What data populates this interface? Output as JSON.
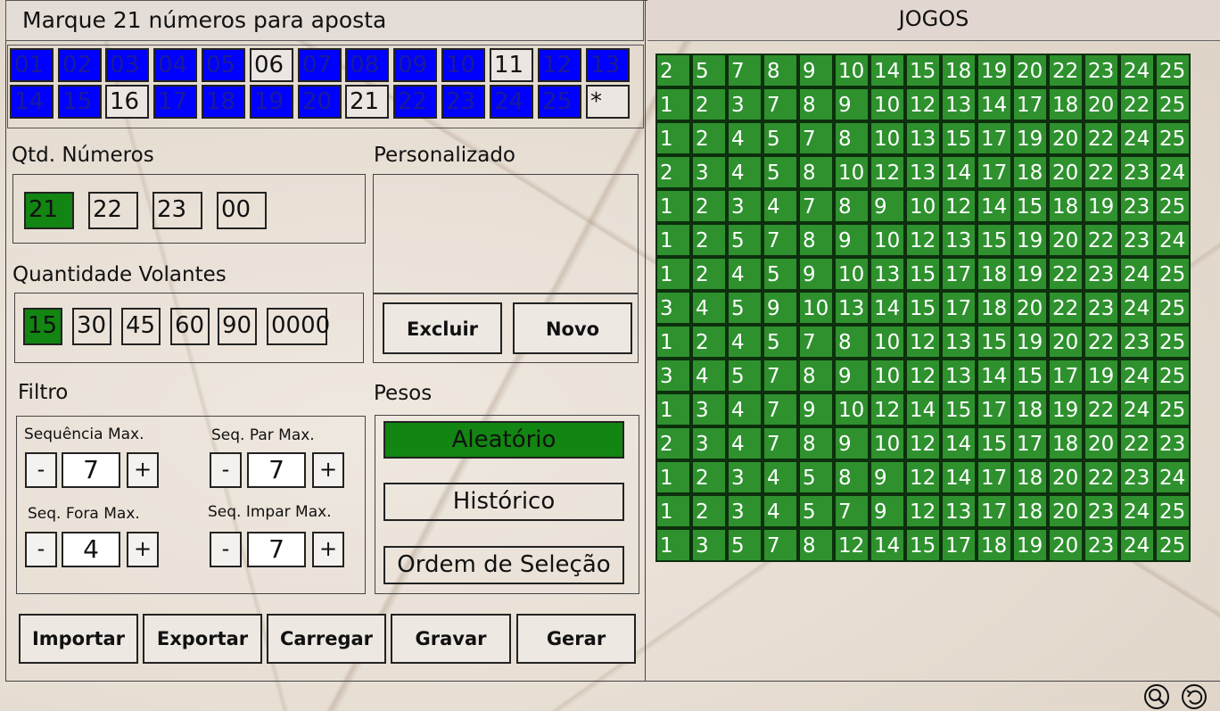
{
  "header": {
    "left_title": "Marque 21 números para aposta",
    "right_title": "JOGOS"
  },
  "numbers": [
    {
      "label": "01",
      "selected": true
    },
    {
      "label": "02",
      "selected": true
    },
    {
      "label": "03",
      "selected": true
    },
    {
      "label": "04",
      "selected": true
    },
    {
      "label": "05",
      "selected": true
    },
    {
      "label": "06",
      "selected": false
    },
    {
      "label": "07",
      "selected": true
    },
    {
      "label": "08",
      "selected": true
    },
    {
      "label": "09",
      "selected": true
    },
    {
      "label": "10",
      "selected": true
    },
    {
      "label": "11",
      "selected": false
    },
    {
      "label": "12",
      "selected": true
    },
    {
      "label": "13",
      "selected": true
    },
    {
      "label": "14",
      "selected": true
    },
    {
      "label": "15",
      "selected": true
    },
    {
      "label": "16",
      "selected": false
    },
    {
      "label": "17",
      "selected": true
    },
    {
      "label": "18",
      "selected": true
    },
    {
      "label": "19",
      "selected": true
    },
    {
      "label": "20",
      "selected": true
    },
    {
      "label": "21",
      "selected": false
    },
    {
      "label": "22",
      "selected": true
    },
    {
      "label": "23",
      "selected": true
    },
    {
      "label": "24",
      "selected": true
    },
    {
      "label": "25",
      "selected": true
    },
    {
      "label": "*",
      "selected": false
    }
  ],
  "qtd_numeros": {
    "title": "Qtd. Números",
    "options": [
      "21",
      "22",
      "23",
      "00"
    ],
    "active": "21"
  },
  "personalizado": {
    "title": "Personalizado",
    "excluir_label": "Excluir",
    "novo_label": "Novo"
  },
  "volantes": {
    "title": "Quantidade Volantes",
    "options": [
      "15",
      "30",
      "45",
      "60",
      "90",
      "0000"
    ],
    "active": "15"
  },
  "filtro": {
    "title": "Filtro",
    "seq_max_label": "Sequência Max.",
    "seq_max_value": "7",
    "seq_par_label": "Seq. Par Max.",
    "seq_par_value": "7",
    "seq_fora_label": "Seq. Fora Max.",
    "seq_fora_value": "4",
    "seq_impar_label": "Seq. Impar Max.",
    "seq_impar_value": "7",
    "minus": "-",
    "plus": "+"
  },
  "pesos": {
    "title": "Pesos",
    "aleatorio": "Aleatório",
    "historico": "Histórico",
    "ordem": "Ordem de Seleção",
    "active": "aleatorio"
  },
  "actions": {
    "importar": "Importar",
    "exportar": "Exportar",
    "carregar": "Carregar",
    "gravar": "Gravar",
    "gerar": "Gerar"
  },
  "jogos": [
    [
      "2",
      "5",
      "7",
      "8",
      "9",
      "10",
      "14",
      "15",
      "18",
      "19",
      "20",
      "22",
      "23",
      "24",
      "25"
    ],
    [
      "1",
      "2",
      "3",
      "7",
      "8",
      "9",
      "10",
      "12",
      "13",
      "14",
      "17",
      "18",
      "20",
      "22",
      "25"
    ],
    [
      "1",
      "2",
      "4",
      "5",
      "7",
      "8",
      "10",
      "13",
      "15",
      "17",
      "19",
      "20",
      "22",
      "24",
      "25"
    ],
    [
      "2",
      "3",
      "4",
      "5",
      "8",
      "10",
      "12",
      "13",
      "14",
      "17",
      "18",
      "20",
      "22",
      "23",
      "24"
    ],
    [
      "1",
      "2",
      "3",
      "4",
      "7",
      "8",
      "9",
      "10",
      "12",
      "14",
      "15",
      "18",
      "19",
      "23",
      "25"
    ],
    [
      "1",
      "2",
      "5",
      "7",
      "8",
      "9",
      "10",
      "12",
      "13",
      "15",
      "19",
      "20",
      "22",
      "23",
      "24"
    ],
    [
      "1",
      "2",
      "4",
      "5",
      "9",
      "10",
      "13",
      "15",
      "17",
      "18",
      "19",
      "22",
      "23",
      "24",
      "25"
    ],
    [
      "3",
      "4",
      "5",
      "9",
      "10",
      "13",
      "14",
      "15",
      "17",
      "18",
      "20",
      "22",
      "23",
      "24",
      "25"
    ],
    [
      "1",
      "2",
      "4",
      "5",
      "7",
      "8",
      "10",
      "12",
      "13",
      "15",
      "19",
      "20",
      "22",
      "23",
      "25"
    ],
    [
      "3",
      "4",
      "5",
      "7",
      "8",
      "9",
      "10",
      "12",
      "13",
      "14",
      "15",
      "17",
      "19",
      "24",
      "25"
    ],
    [
      "1",
      "3",
      "4",
      "7",
      "9",
      "10",
      "12",
      "14",
      "15",
      "17",
      "18",
      "19",
      "22",
      "24",
      "25"
    ],
    [
      "2",
      "3",
      "4",
      "7",
      "8",
      "9",
      "10",
      "12",
      "14",
      "15",
      "17",
      "18",
      "20",
      "22",
      "23"
    ],
    [
      "1",
      "2",
      "3",
      "4",
      "5",
      "8",
      "9",
      "12",
      "14",
      "17",
      "18",
      "20",
      "22",
      "23",
      "24"
    ],
    [
      "1",
      "2",
      "3",
      "4",
      "5",
      "7",
      "9",
      "12",
      "13",
      "17",
      "18",
      "20",
      "23",
      "24",
      "25"
    ],
    [
      "1",
      "3",
      "5",
      "7",
      "8",
      "12",
      "14",
      "15",
      "17",
      "18",
      "19",
      "20",
      "23",
      "24",
      "25"
    ]
  ],
  "colors": {
    "selected_number": "#0000ff",
    "active_option": "#128512",
    "game_cell": "#2e912e"
  },
  "icons": {
    "search": "search-icon",
    "back": "back-icon"
  }
}
